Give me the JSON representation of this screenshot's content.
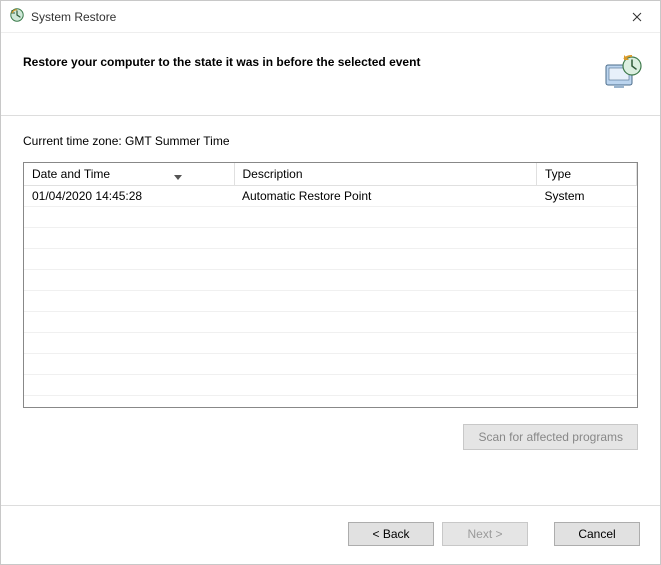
{
  "window": {
    "title": "System Restore"
  },
  "header": {
    "heading": "Restore your computer to the state it was in before the selected event"
  },
  "content": {
    "timezone_label": "Current time zone: GMT Summer Time",
    "columns": {
      "date": "Date and Time",
      "desc": "Description",
      "type": "Type"
    },
    "rows": [
      {
        "date": "01/04/2020 14:45:28",
        "desc": "Automatic Restore Point",
        "type": "System"
      }
    ],
    "scan_button": "Scan for affected programs"
  },
  "footer": {
    "back": "< Back",
    "next": "Next >",
    "cancel": "Cancel"
  }
}
